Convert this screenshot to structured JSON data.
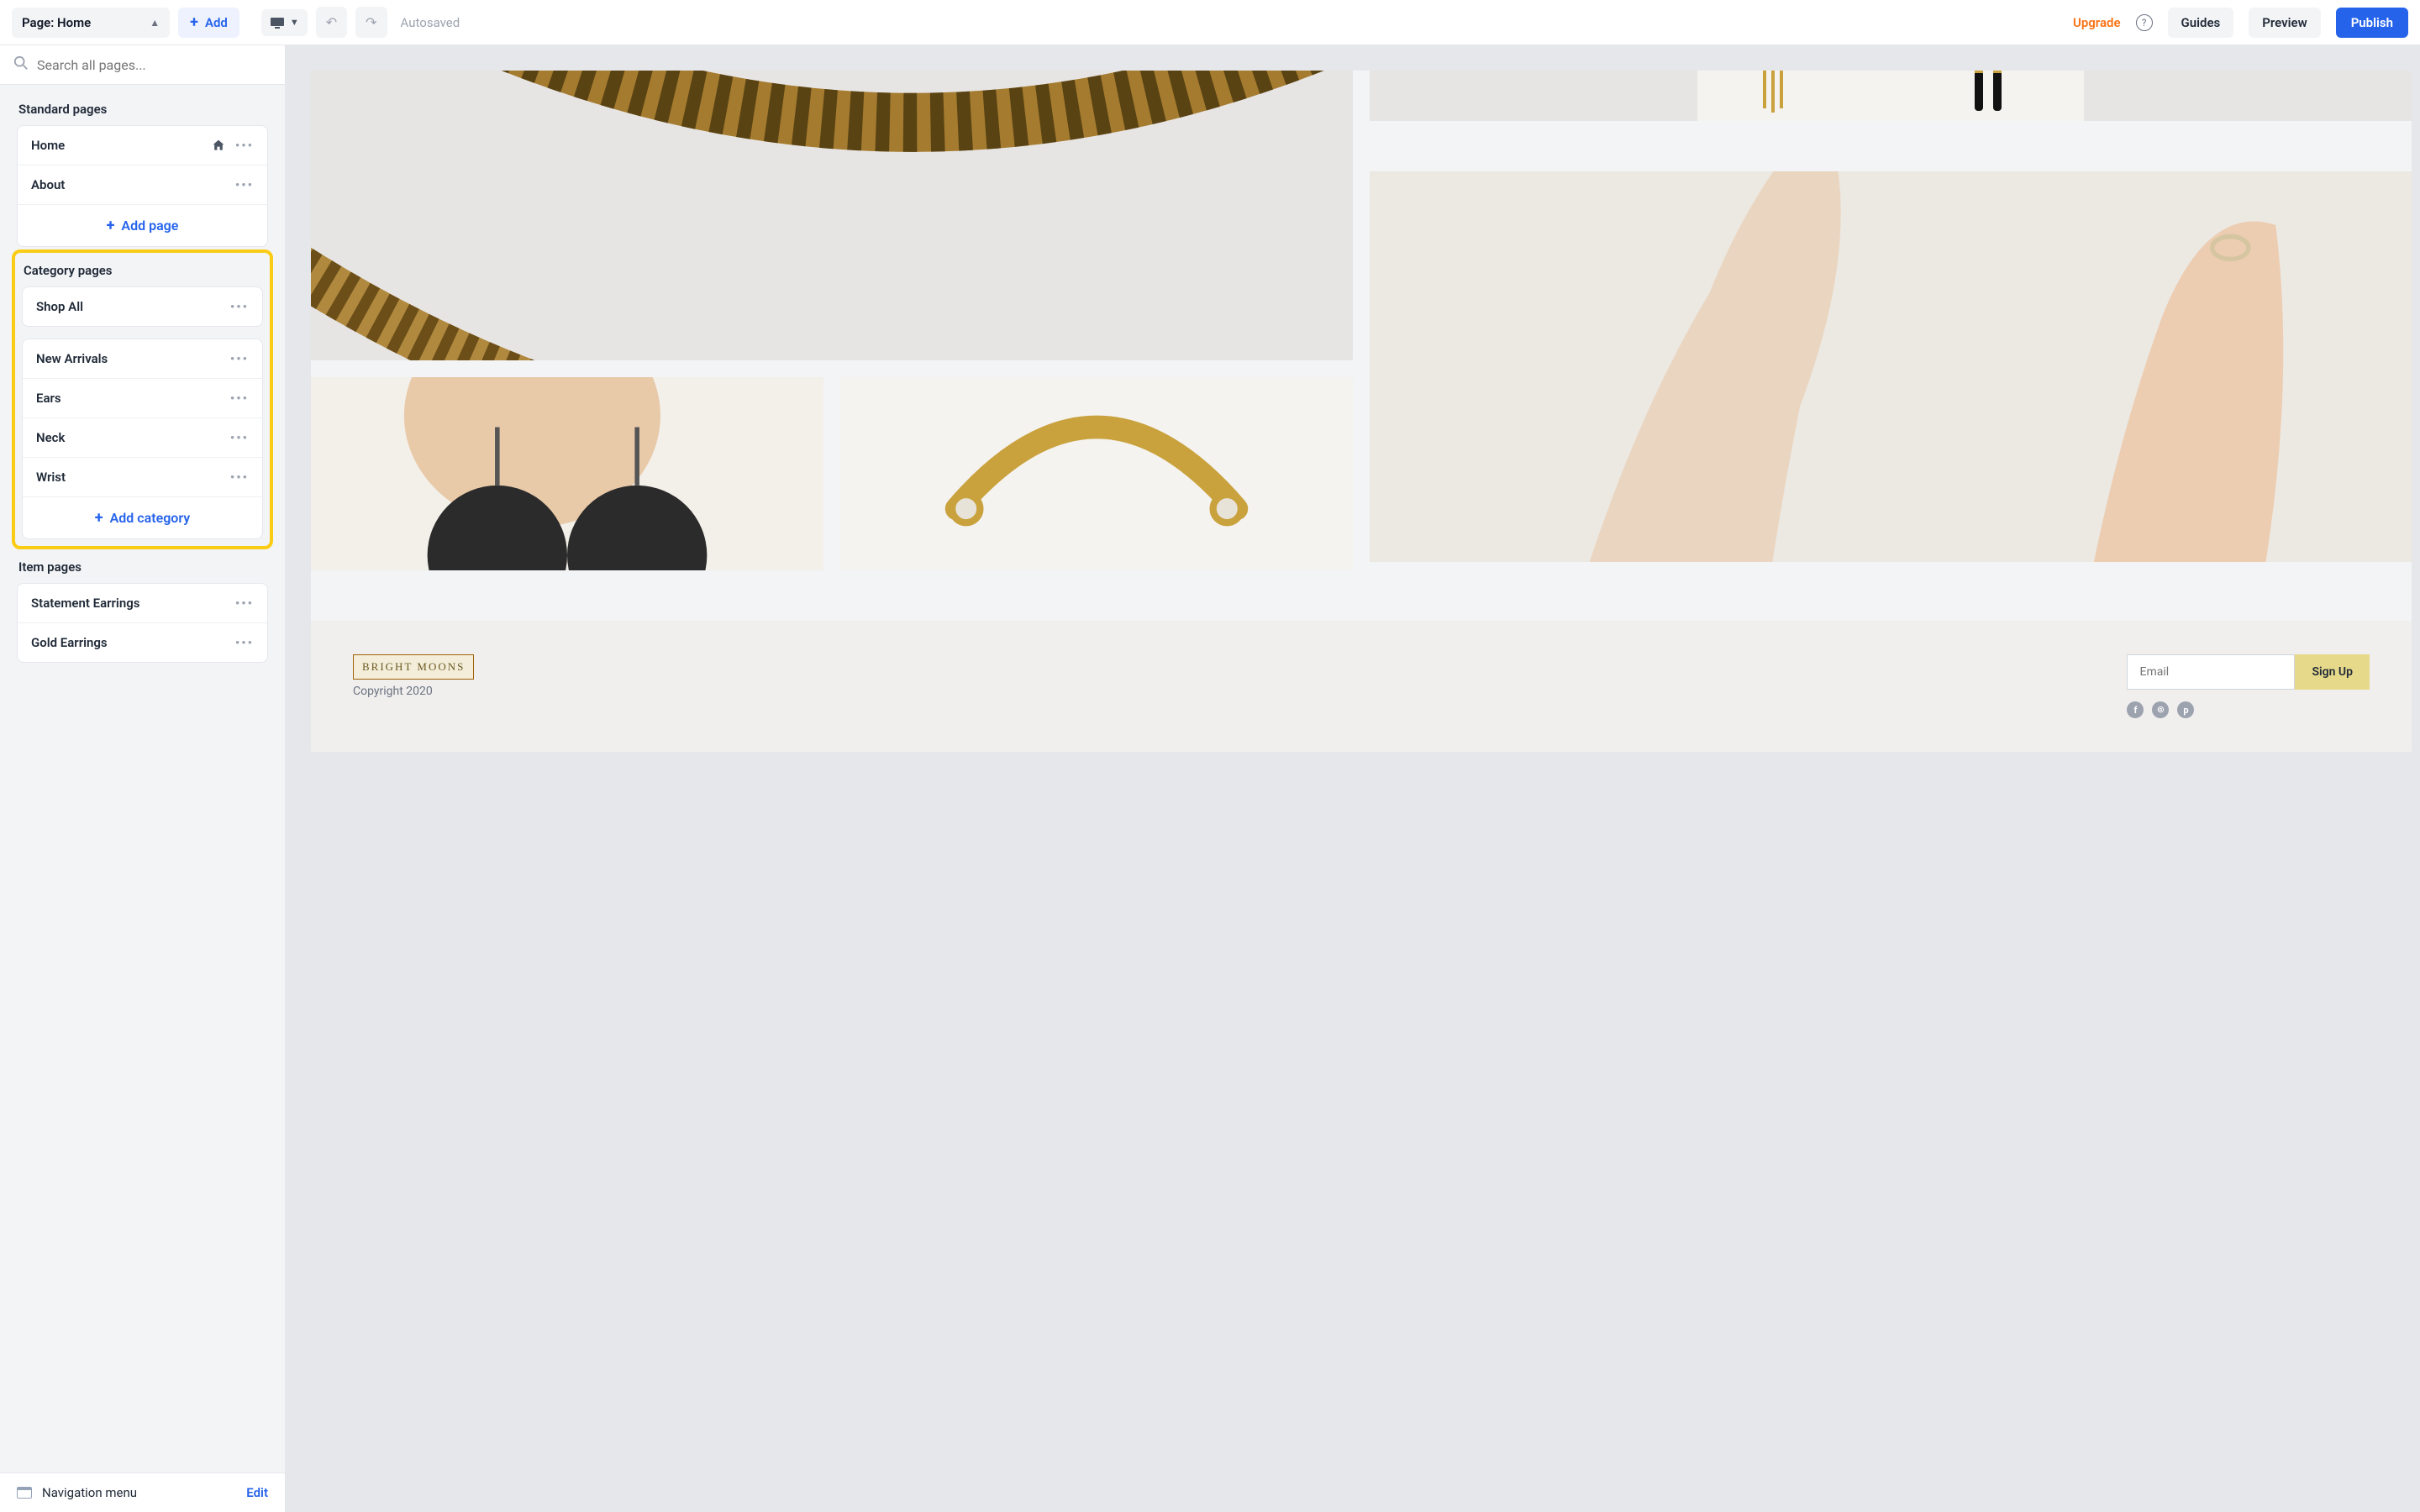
{
  "topbar": {
    "page_label": "Page: Home",
    "add_label": "Add",
    "autosaved": "Autosaved",
    "upgrade": "Upgrade",
    "guides": "Guides",
    "preview": "Preview",
    "publish": "Publish"
  },
  "search": {
    "placeholder": "Search all pages..."
  },
  "sections": {
    "standard": "Standard pages",
    "category": "Category pages",
    "item": "Item pages"
  },
  "standard_pages": [
    "Home",
    "About"
  ],
  "add_page": "Add page",
  "category_pages": [
    "Shop All",
    "New Arrivals",
    "Ears",
    "Neck",
    "Wrist"
  ],
  "add_category": "Add category",
  "item_pages": [
    "Statement Earrings",
    "Gold Earrings"
  ],
  "nav_menu": "Navigation menu",
  "edit": "Edit",
  "site": {
    "logo": "BRIGHT MOONS",
    "email_placeholder": "Email",
    "signup": "Sign Up",
    "copyright": "Copyright 2020",
    "social": [
      "f",
      "ig",
      "p"
    ]
  },
  "colors": {
    "primary": "#2563eb",
    "accent_orange": "#f97316",
    "highlight": "#facc15",
    "signup_bg": "#e6d98a"
  }
}
